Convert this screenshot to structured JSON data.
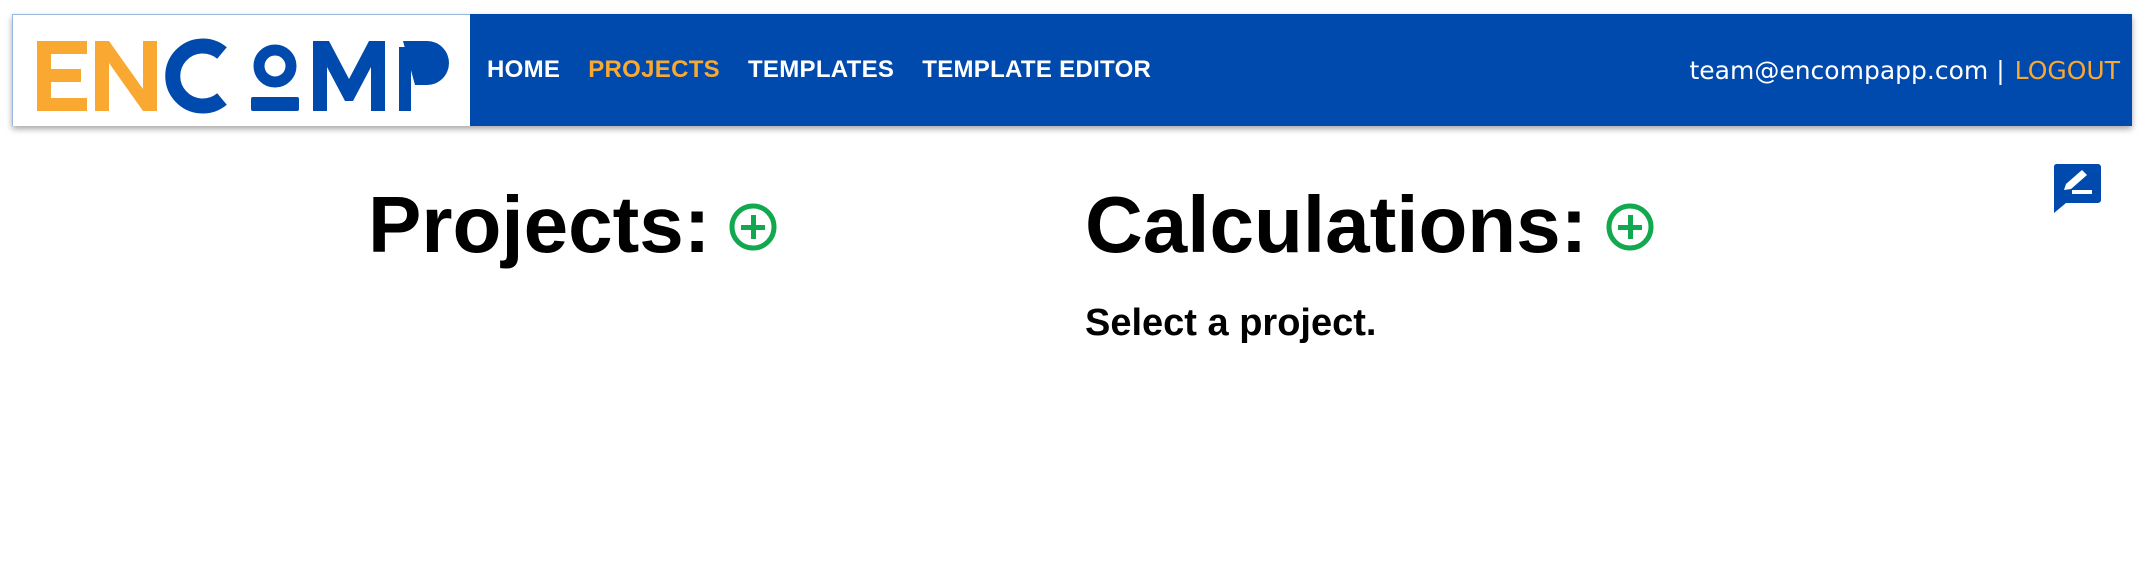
{
  "logo": {
    "text": "ENCOMP",
    "colors": {
      "primary": "#004aad",
      "accent": "#f9a832"
    }
  },
  "nav": {
    "items": [
      {
        "label": "HOME",
        "active": false
      },
      {
        "label": "PROJECTS",
        "active": true
      },
      {
        "label": "TEMPLATES",
        "active": false
      },
      {
        "label": "TEMPLATE EDITOR",
        "active": false
      }
    ],
    "user_email": "team@encompapp.com",
    "separator": "|",
    "logout_label": "LOGOUT"
  },
  "feedback": {
    "icon": "feedback-edit-icon"
  },
  "projects": {
    "heading": "Projects:",
    "add_icon": "plus-circle-icon"
  },
  "calculations": {
    "heading": "Calculations:",
    "add_icon": "plus-circle-icon",
    "empty_message": "Select a project."
  },
  "colors": {
    "navbar_bg": "#004aad",
    "active_link": "#f9a832",
    "add_button": "#12a850"
  }
}
